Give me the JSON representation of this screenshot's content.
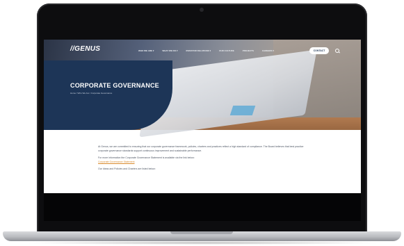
{
  "site": {
    "logo": "//GENUS",
    "nav": [
      {
        "label": "WHO WE ARE ▾"
      },
      {
        "label": "WHAT WE DO ▾"
      },
      {
        "label": "INVESTOR RELATIONS ▾"
      },
      {
        "label": "OUR CULTURE"
      },
      {
        "label": "PROJECTS"
      },
      {
        "label": "CAREERS ▾"
      }
    ],
    "contact_label": "CONTACT"
  },
  "hero": {
    "title": "CORPORATE GOVERNANCE",
    "breadcrumb": "Home / Who We Are / Corporate Governance"
  },
  "content": {
    "paragraph_1": "At Genus, we are committed to ensuring that our corporate governance framework, policies, charters and practices reflect a high standard of compliance. The Board believes that best practice corporate governance standards support continuous improvement and sustainable performance.",
    "paragraph_2": "For more information the Corporate Governance Statement is available via the link below:",
    "link_label": "Corporate Governance Statement",
    "paragraph_3": "Our Ideas and Policies and Charters are listed below:"
  },
  "colors": {
    "brand_navy": "#1d3557",
    "link_orange": "#d98a2b",
    "bezel": "#0d0d0f"
  }
}
